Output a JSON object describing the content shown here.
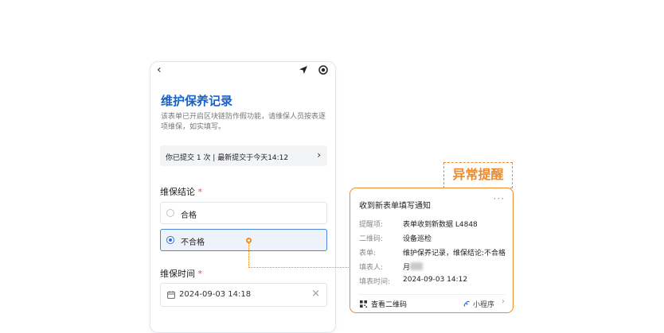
{
  "form": {
    "title": "维护保养记录",
    "description": "该表单已开启区块链防作假功能，请维保人员按表逐项维保，如实填写。",
    "submit_summary": "你已提交 1 次 | 最新提交于今天14:12",
    "conclusion_label": "维保结论",
    "required_mark": "*",
    "options": [
      {
        "label": "合格",
        "selected": false
      },
      {
        "label": "不合格",
        "selected": true
      }
    ],
    "time_label": "维保时间",
    "time_value": "2024-09-03 14:18"
  },
  "alert": {
    "tag": "异常提醒"
  },
  "notification": {
    "title": "收到新表单填写通知",
    "more": "···",
    "rows": [
      {
        "key": "提醒项:",
        "value": "表单收到新数据 L4848"
      },
      {
        "key": "二维码:",
        "value": "设备巡检"
      },
      {
        "key": "表单:",
        "value": "维护保养记录，维保结论:不合格"
      },
      {
        "key": "填表人:",
        "value": "月"
      },
      {
        "key": "填表时间:",
        "value": "2024-09-03 14:12"
      }
    ],
    "qr_action": "查看二维码",
    "mini_program": "小程序"
  },
  "colors": {
    "brand_blue": "#1762c9",
    "accent_orange": "#ef8a2c",
    "required_red": "#e34d4d"
  }
}
